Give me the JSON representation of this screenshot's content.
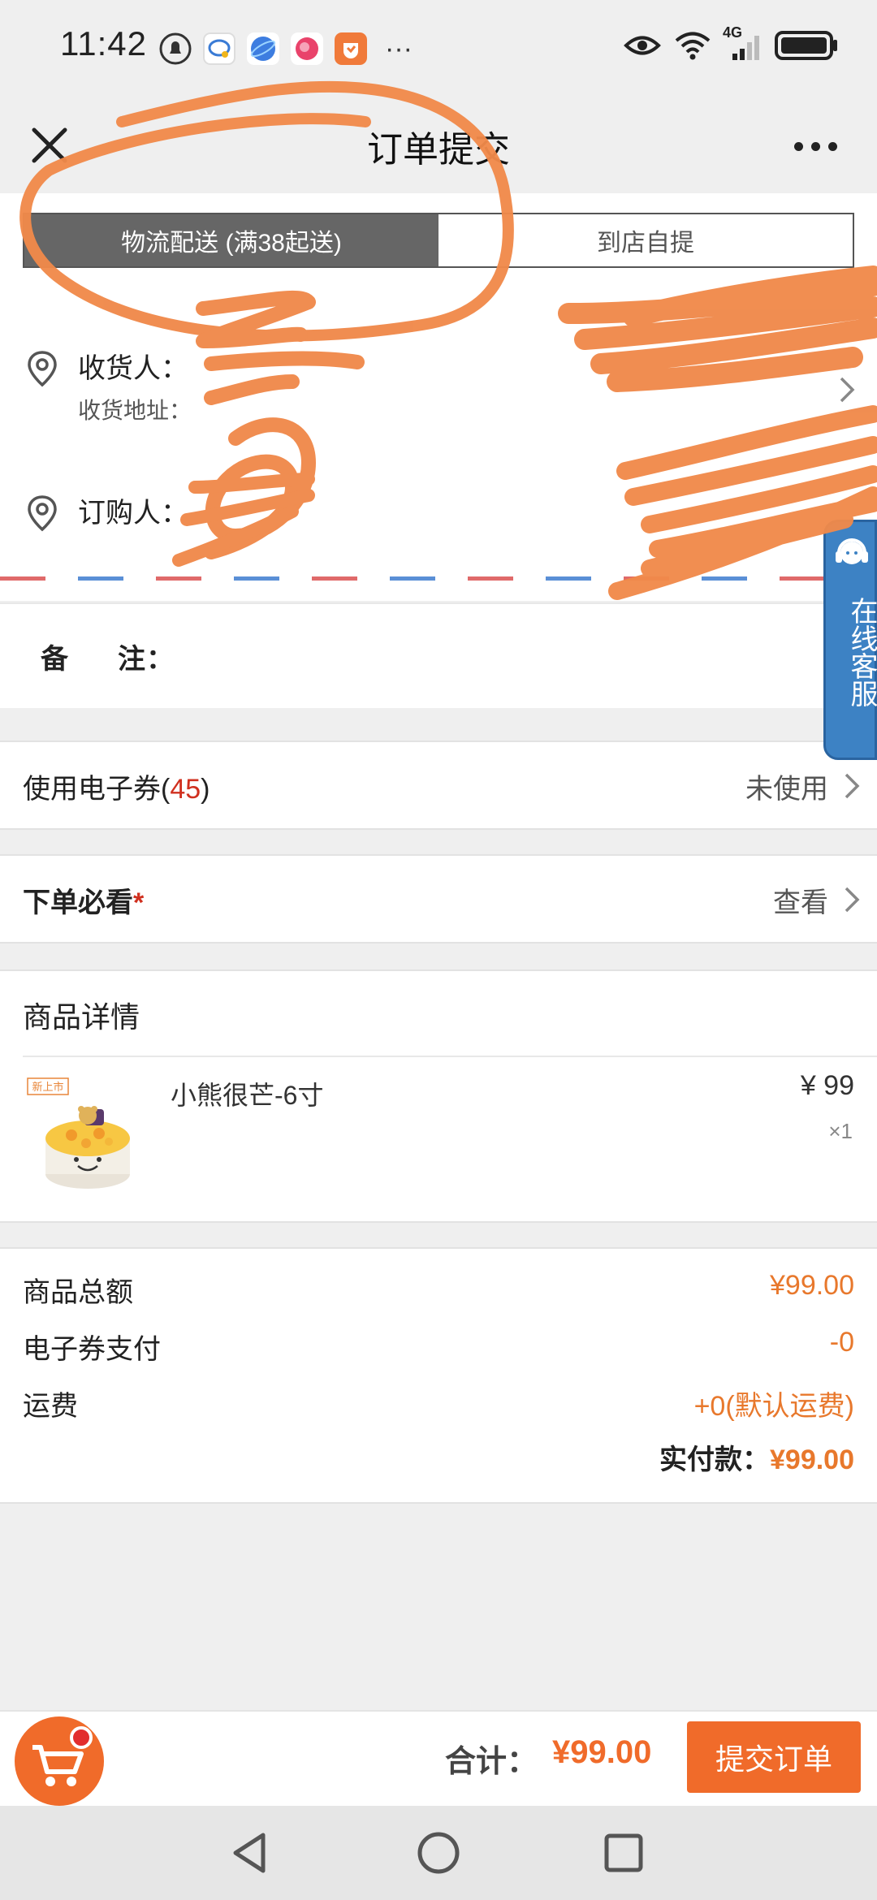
{
  "status_bar": {
    "time": "11:42",
    "network": "4G",
    "notification_icons": [
      "bell-icon",
      "chat-icon",
      "browser-icon",
      "social-icon",
      "shopping-icon"
    ]
  },
  "header": {
    "title": "订单提交"
  },
  "delivery": {
    "tabs": [
      {
        "label": "物流配送 (满38起送)",
        "active": true
      },
      {
        "label": "到店自提",
        "active": false
      }
    ],
    "receiver_label": "收货人：",
    "address_label": "收货地址：",
    "orderer_label": "订购人："
  },
  "remark": {
    "label_a": "备",
    "label_b": "注："
  },
  "coupon": {
    "label": "使用电子券(",
    "count": "45",
    "label_end": ")",
    "value": "未使用"
  },
  "notice": {
    "label": "下单必看",
    "star": "*",
    "value": "查看"
  },
  "goods": {
    "section_title": "商品详情",
    "items": [
      {
        "name": "小熊很芒-6寸",
        "price": "¥ 99",
        "qty": "×1",
        "badge": "新上市"
      }
    ]
  },
  "summary": {
    "rows": [
      {
        "label": "商品总额",
        "value": "¥99.00"
      },
      {
        "label": "电子券支付",
        "value": "-0"
      },
      {
        "label": "运费",
        "value": "+0(默认运费)"
      }
    ],
    "paid_label": "实付款：",
    "paid_value": "¥99.00"
  },
  "customer_service": {
    "label": "在线客服"
  },
  "bottom": {
    "total_label": "合计：",
    "total_value": "¥99.00",
    "submit_label": "提交订单"
  },
  "colors": {
    "accent": "#f06b2a",
    "price": "#e8782c",
    "red": "#d0301f",
    "service_blue": "#3d82c4"
  }
}
